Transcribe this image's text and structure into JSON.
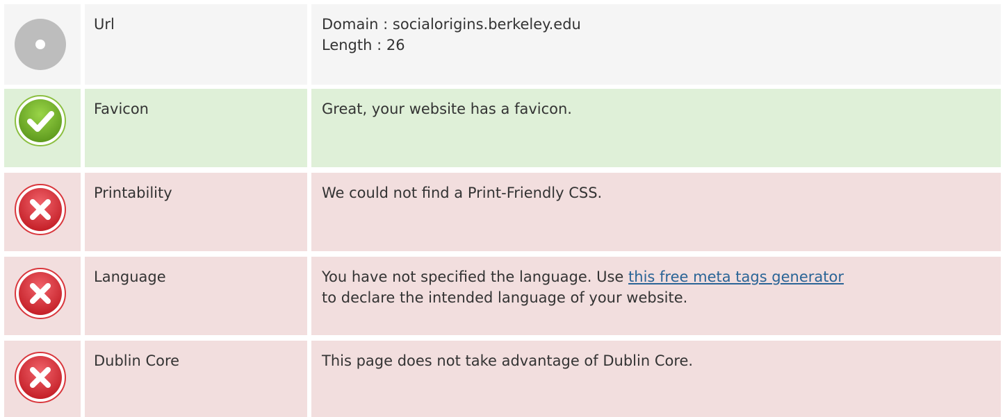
{
  "rows": [
    {
      "status": "neutral",
      "icon": "info-circle-icon",
      "label": "Url",
      "lines": [
        "Domain : socialorigins.berkeley.edu",
        "Length : 26"
      ]
    },
    {
      "status": "pass",
      "icon": "check-circle-icon",
      "label": "Favicon",
      "text": "Great, your website has a favicon."
    },
    {
      "status": "fail",
      "icon": "x-circle-icon",
      "label": "Printability",
      "text": "We could not find a Print-Friendly CSS."
    },
    {
      "status": "fail",
      "icon": "x-circle-icon",
      "label": "Language",
      "text_before": "You have not specified the language. Use ",
      "link_text": "this free meta tags generator",
      "text_after": "to declare the intended language of your website."
    },
    {
      "status": "fail",
      "icon": "x-circle-icon",
      "label": "Dublin Core",
      "text": "This page does not take advantage of Dublin Core."
    }
  ],
  "colors": {
    "neutral_bg": "#f5f5f5",
    "pass_bg": "#dff0d8",
    "fail_bg": "#f2dede",
    "link": "#2a6496",
    "pass_icon": "#7cb82f",
    "fail_icon": "#e0393e",
    "neutral_icon": "#bdbdbd"
  }
}
